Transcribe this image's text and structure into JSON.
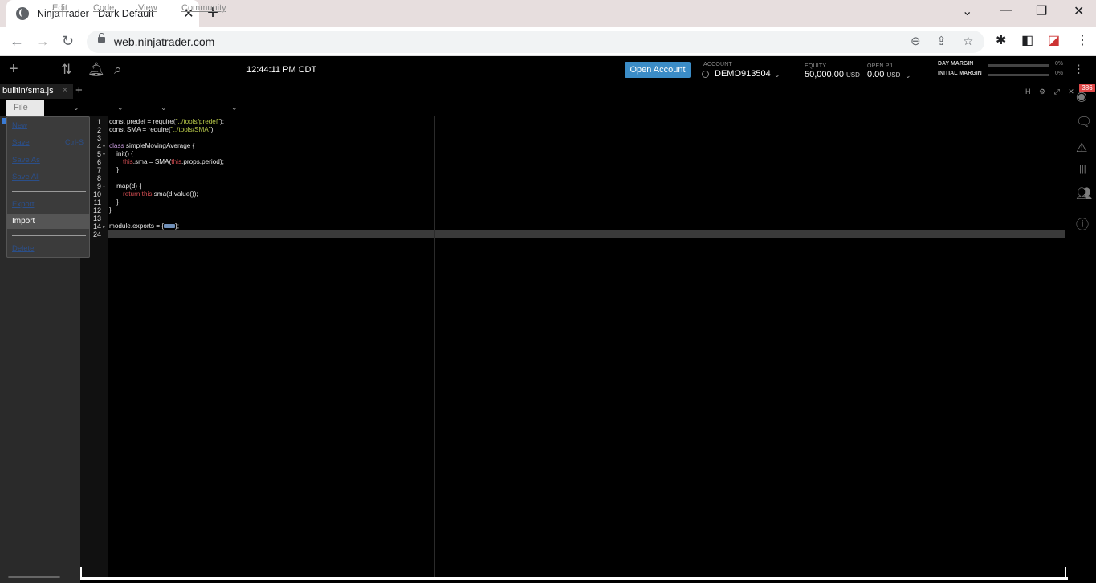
{
  "browser": {
    "tab_title": "NinjaTrader - Dark Default",
    "tab_close": "✕",
    "new_tab": "+",
    "url": "web.ninjatrader.com",
    "win_minimize": "⌄",
    "win_min": "—",
    "win_restore": "❐",
    "win_close": "✕"
  },
  "header": {
    "clock": "12:44:11 PM CDT",
    "open_account_label": "Open Account",
    "account_label": "ACCOUNT",
    "account_value": "DEMO913504",
    "equity_label": "EQUITY",
    "equity_value": "50,000.00",
    "equity_currency": "USD",
    "open_pl_label": "OPEN P/L",
    "open_pl_value": "0.00",
    "open_pl_currency": "USD",
    "day_margin_label": "DAY MARGIN",
    "day_margin_pct": "0%",
    "initial_margin_label": "INITIAL MARGIN",
    "initial_margin_pct": "0%"
  },
  "rail": {
    "badge": "386"
  },
  "editor": {
    "file_tab": "builtin/sma.js",
    "file_tab_close": "×",
    "tab_add": "+",
    "pane_controls": "H ⚙ ⤢ ✕",
    "menus": [
      {
        "label": "File"
      },
      {
        "label": "Edit"
      },
      {
        "label": "Code"
      },
      {
        "label": "View"
      },
      {
        "label": "Community"
      }
    ],
    "file_menu": {
      "new": "New",
      "save": "Save",
      "save_shortcut": "Ctrl-S",
      "save_as": "Save As",
      "save_all": "Save All",
      "export": "Export",
      "import": "Import",
      "delete": "Delete"
    },
    "line_numbers": [
      "1",
      "2",
      "3",
      "4",
      "5",
      "6",
      "7",
      "8",
      "9",
      "10",
      "11",
      "12",
      "13",
      "14",
      "24"
    ],
    "code": {
      "l1_a": "const predef = require(",
      "l1_b": "\"../tools/predef\"",
      "l1_c": ");",
      "l2_a": "const SMA = require(",
      "l2_b": "\"../tools/SMA\"",
      "l2_c": ");",
      "l4_a": "class",
      "l4_b": " simpleMovingAverage {",
      "l5": "    init() {",
      "l6_a": "this",
      "l6_b": ".sma = SMA(",
      "l6_c": "this",
      "l6_d": ".props.period);",
      "l7": "    }",
      "l9": "    map(d) {",
      "l10_a": "return ",
      "l10_b": "this",
      "l10_c": ".sma(d.value());",
      "l11": "    }",
      "l12": "}",
      "l14_a": "module.exports = {",
      "l14_c": "};"
    }
  }
}
